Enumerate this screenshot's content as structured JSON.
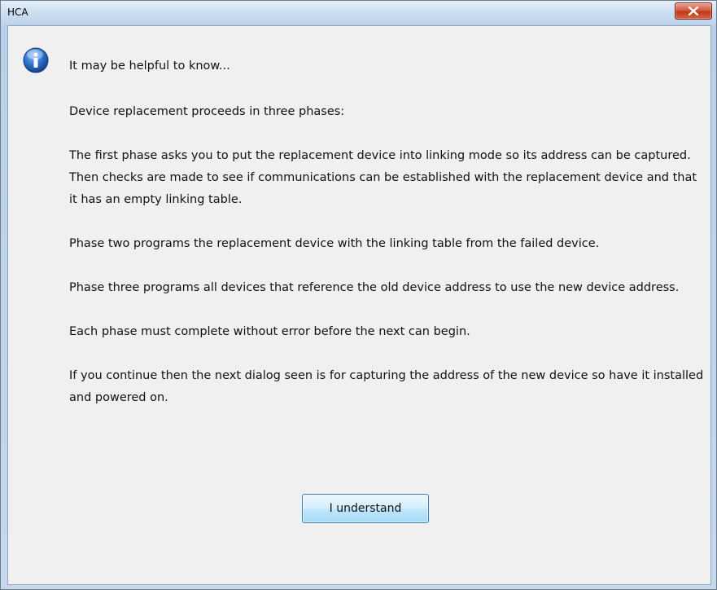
{
  "window": {
    "title": "HCA"
  },
  "dialog": {
    "intro": "It may be helpful to know...",
    "paragraphs": [
      "Device replacement proceeds in three phases:",
      "The first phase asks you to put the replacement device into linking mode so its address can be captured. Then checks are made to see if communications can be established with the replacement device and that it has an empty linking table.",
      "Phase two programs the replacement device with the linking table from the failed device.",
      "Phase three programs all devices that reference the old device address to use the new device address.",
      "Each phase must complete without error before the next can begin.",
      "If you continue then the next dialog seen is for capturing the address of the new device so have it installed and powered on."
    ],
    "button_label": "I understand",
    "icon": "info-icon"
  },
  "colors": {
    "close_button": "#c0391c",
    "info_icon": "#1f5fb8",
    "button_border": "#3c7fb1"
  }
}
